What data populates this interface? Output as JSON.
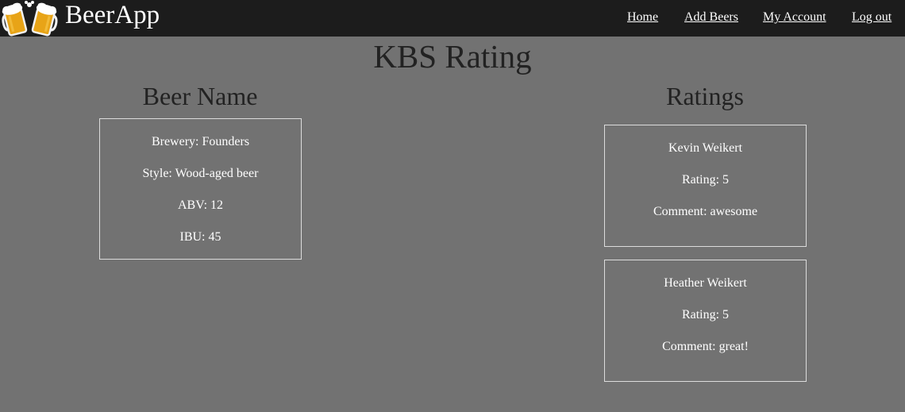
{
  "nav": {
    "brand": "BeerApp",
    "logo_icon": "beer-mugs-icon",
    "links": [
      {
        "label": "Home"
      },
      {
        "label": "Add Beers"
      },
      {
        "label": "My Account"
      },
      {
        "label": "Log out"
      }
    ]
  },
  "page": {
    "title": "KBS Rating"
  },
  "beer": {
    "heading": "Beer Name",
    "brewery": "Brewery: Founders",
    "style": "Style: Wood-aged beer",
    "abv": "ABV: 12",
    "ibu": "IBU: 45"
  },
  "ratings": {
    "heading": "Ratings",
    "items": [
      {
        "user": "Kevin Weikert",
        "rating": "Rating: 5",
        "comment": "Comment: awesome"
      },
      {
        "user": "Heather Weikert",
        "rating": "Rating: 5",
        "comment": "Comment: great!"
      }
    ]
  },
  "colors": {
    "navbar": "#1c1c1c",
    "background": "#727272",
    "heading_text": "#222222",
    "card_text": "#ffffff",
    "card_border": "#dcdcdc",
    "beer_amber": "#e8a417"
  }
}
